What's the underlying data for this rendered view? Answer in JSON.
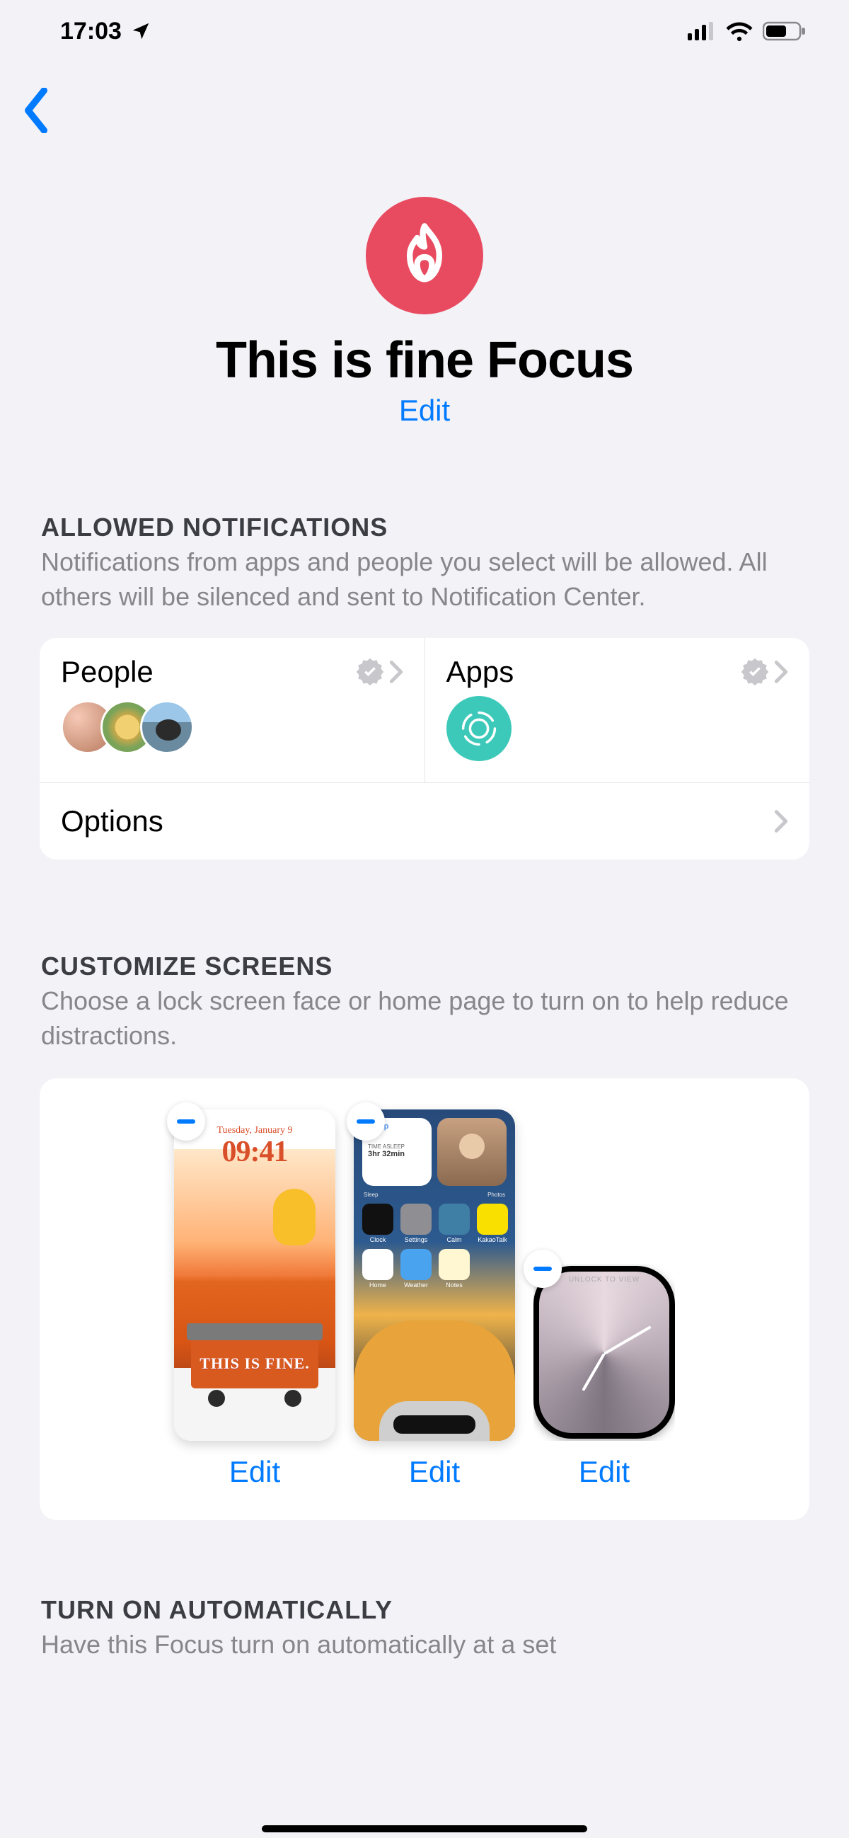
{
  "statusBar": {
    "time": "17:03"
  },
  "header": {
    "title": "This is fine Focus",
    "editLabel": "Edit"
  },
  "sections": {
    "allowed": {
      "title": "ALLOWED NOTIFICATIONS",
      "desc": "Notifications from apps and people you select will be allowed. All others will be silenced and sent to Notification Center.",
      "peopleLabel": "People",
      "appsLabel": "Apps",
      "optionsLabel": "Options"
    },
    "screens": {
      "title": "CUSTOMIZE SCREENS",
      "desc": "Choose a lock screen face or home page to turn on to help reduce distractions.",
      "editLabel": "Edit",
      "lock": {
        "date": "Tuesday, January 9",
        "time": "09:41",
        "caption": "THIS IS FINE."
      },
      "home": {
        "sleepWidgetTitle": "Sleep",
        "sleepWidgetLine": "TIME ASLEEP",
        "sleepWidgetVal": "3hr 32min",
        "sleepLabel": "Sleep",
        "photosLabel": "Photos",
        "iconLabels": [
          "Clock",
          "Settings",
          "Calm",
          "KakaoTalk",
          "Home",
          "Weather",
          "Notes"
        ]
      },
      "watch": {
        "unlockLabel": "UNLOCK TO VIEW"
      }
    },
    "auto": {
      "title": "TURN ON AUTOMATICALLY",
      "desc": "Have this Focus turn on automatically at a set"
    }
  }
}
